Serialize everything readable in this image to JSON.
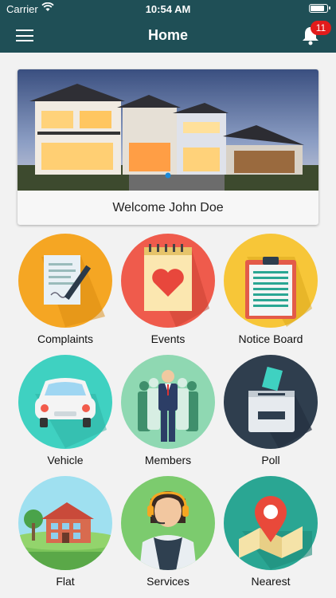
{
  "status_bar": {
    "carrier": "Carrier",
    "time": "10:54 AM"
  },
  "nav": {
    "title": "Home",
    "notification_count": "11"
  },
  "welcome": {
    "message": "Welcome John Doe"
  },
  "tiles": [
    {
      "label": "Complaints",
      "icon": "complaint-document-icon",
      "color": "#f5a623"
    },
    {
      "label": "Events",
      "icon": "calendar-heart-icon",
      "color": "#ef5b4c"
    },
    {
      "label": "Notice Board",
      "icon": "clipboard-icon",
      "color": "#f7c638"
    },
    {
      "label": "Vehicle",
      "icon": "car-icon",
      "color": "#3fd1c1"
    },
    {
      "label": "Members",
      "icon": "people-icon",
      "color": "#8fd8b2"
    },
    {
      "label": "Poll",
      "icon": "ballot-box-icon",
      "color": "#2f3e4e"
    },
    {
      "label": "Flat",
      "icon": "house-icon",
      "color": "#9fe0f0"
    },
    {
      "label": "Services",
      "icon": "support-agent-icon",
      "color": "#7ccb6e"
    },
    {
      "label": "Nearest",
      "icon": "map-pin-icon",
      "color": "#2aa693"
    }
  ]
}
